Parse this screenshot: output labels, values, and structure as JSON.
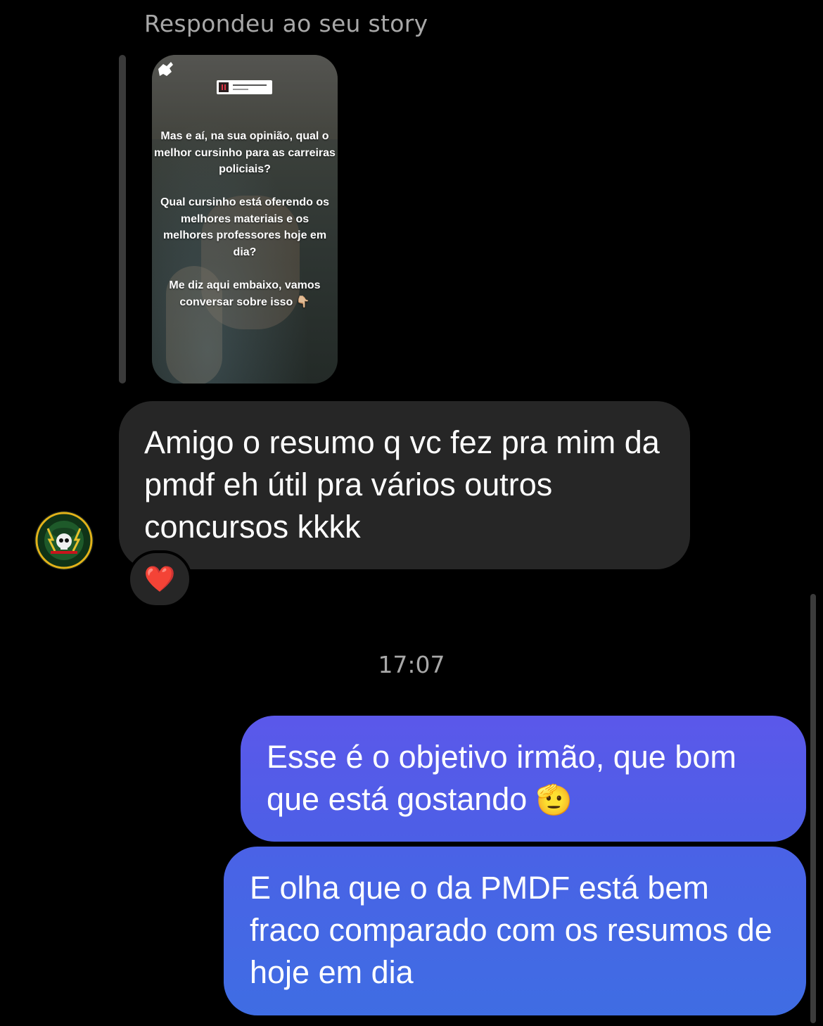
{
  "story_reply": {
    "header": "Respondeu ao seu story",
    "story_text": {
      "paragraph1": "Mas e aí, na sua opinião, qual o melhor cursinho para as carreiras policiais?",
      "paragraph2": "Qual cursinho está oferendo os melhores materiais e os melhores professores hoje em dia?",
      "paragraph3": "Me diz aqui embaixo, vamos conversar sobre isso 👇🏼"
    }
  },
  "incoming": {
    "text": "Amigo o resumo q vc fez pra mim da pmdf eh útil pra vários outros concursos kkkk",
    "reaction": "❤️",
    "avatar_icon": "guerreiros-de-goias-logo",
    "avatar_text_top": "GUERREIROS",
    "avatar_text_bottom": "DE GOIÁS"
  },
  "timestamp": "17:07",
  "outgoing": [
    {
      "text": "Esse é o objetivo irmão, que bom que está gostando",
      "emoji": "🫡"
    },
    {
      "text": "E olha que o da PMDF está bem fraco comparado com os resumos de hoje em dia"
    }
  ],
  "colors": {
    "background": "#000000",
    "incoming_bubble": "#262626",
    "outgoing_top": "#5b58ea",
    "outgoing_bottom": "#3f6de3",
    "meta_text": "#a8a8a8"
  }
}
